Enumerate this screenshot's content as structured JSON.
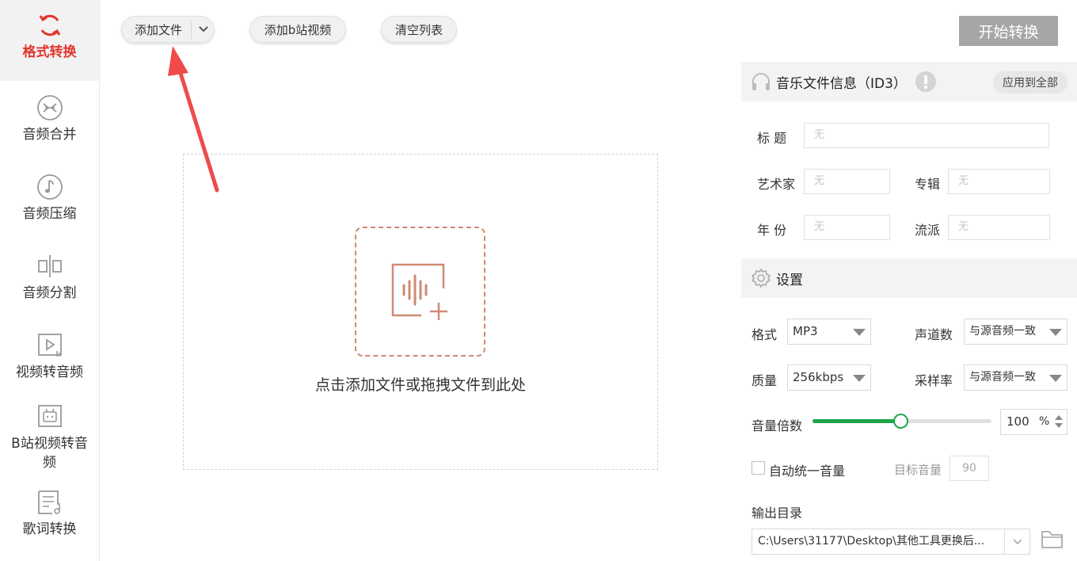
{
  "sidebar": {
    "items": [
      {
        "label": "格式转换",
        "icon": "refresh-icon",
        "active": true
      },
      {
        "label": "音频合并",
        "icon": "merge-icon"
      },
      {
        "label": "音频压缩",
        "icon": "music-note-icon"
      },
      {
        "label": "音频分割",
        "icon": "split-icon"
      },
      {
        "label": "视频转音频",
        "icon": "video-play-icon"
      },
      {
        "label": "B站视频转音频",
        "icon": "bilibili-tv-icon"
      },
      {
        "label": "歌词转换",
        "icon": "lyrics-icon"
      }
    ]
  },
  "toolbar": {
    "add_file": "添加文件",
    "add_bili": "添加b站视频",
    "clear_list": "清空列表",
    "start": "开始转换"
  },
  "dropzone": {
    "hint": "点击添加文件或拖拽文件到此处"
  },
  "id3": {
    "title": "音乐文件信息（ID3）",
    "apply_all": "应用到全部",
    "fields": {
      "title_label": "标  题",
      "artist_label": "艺术家",
      "album_label": "专辑",
      "year_label": "年  份",
      "genre_label": "流派",
      "placeholder": "无"
    }
  },
  "settings": {
    "title": "设置",
    "format_label": "格式",
    "format_value": "MP3",
    "channels_label": "声道数",
    "channels_value": "与源音频一致",
    "quality_label": "质量",
    "quality_value": "256kbps",
    "samplerate_label": "采样率",
    "samplerate_value": "与源音频一致",
    "volume_label": "音量倍数",
    "volume_value": "100",
    "volume_unit": "%",
    "volume_slider_fraction": 0.49,
    "auto_volume_label": "自动统一音量",
    "target_volume_label": "目标音量",
    "target_volume_value": "90",
    "output_label": "输出目录",
    "output_path": "C:\\Users\\31177\\Desktop\\其他工具更换后..."
  },
  "colors": {
    "accent_red": "#e2352e",
    "drop_accent": "#d08a73",
    "slider_green": "#1ea54a",
    "start_button_bg": "#a6a6a6",
    "annotation_arrow": "#ef4b4b"
  }
}
